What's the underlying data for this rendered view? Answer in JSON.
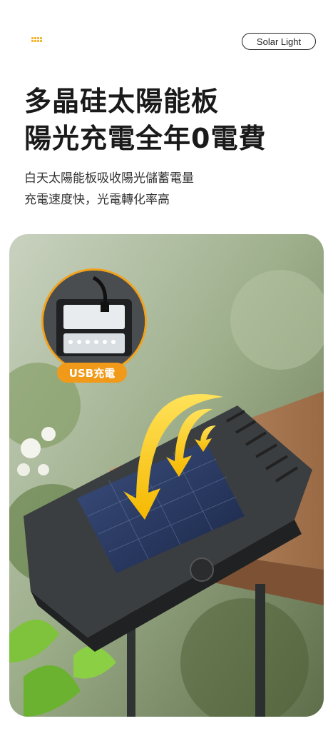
{
  "header": {
    "dots_icon": "grid-dots-icon",
    "badge": "Solar Light",
    "accent_color": "#f2b01e"
  },
  "headline": {
    "line1": "多晶硅太陽能板",
    "line2": "陽光充電全年0電費"
  },
  "description": {
    "line1": "白天太陽能板吸收陽光儲蓄電量",
    "line2": "充電速度快，光電轉化率高"
  },
  "inset": {
    "label": "USB充電",
    "label_color": "#f19a1a"
  }
}
